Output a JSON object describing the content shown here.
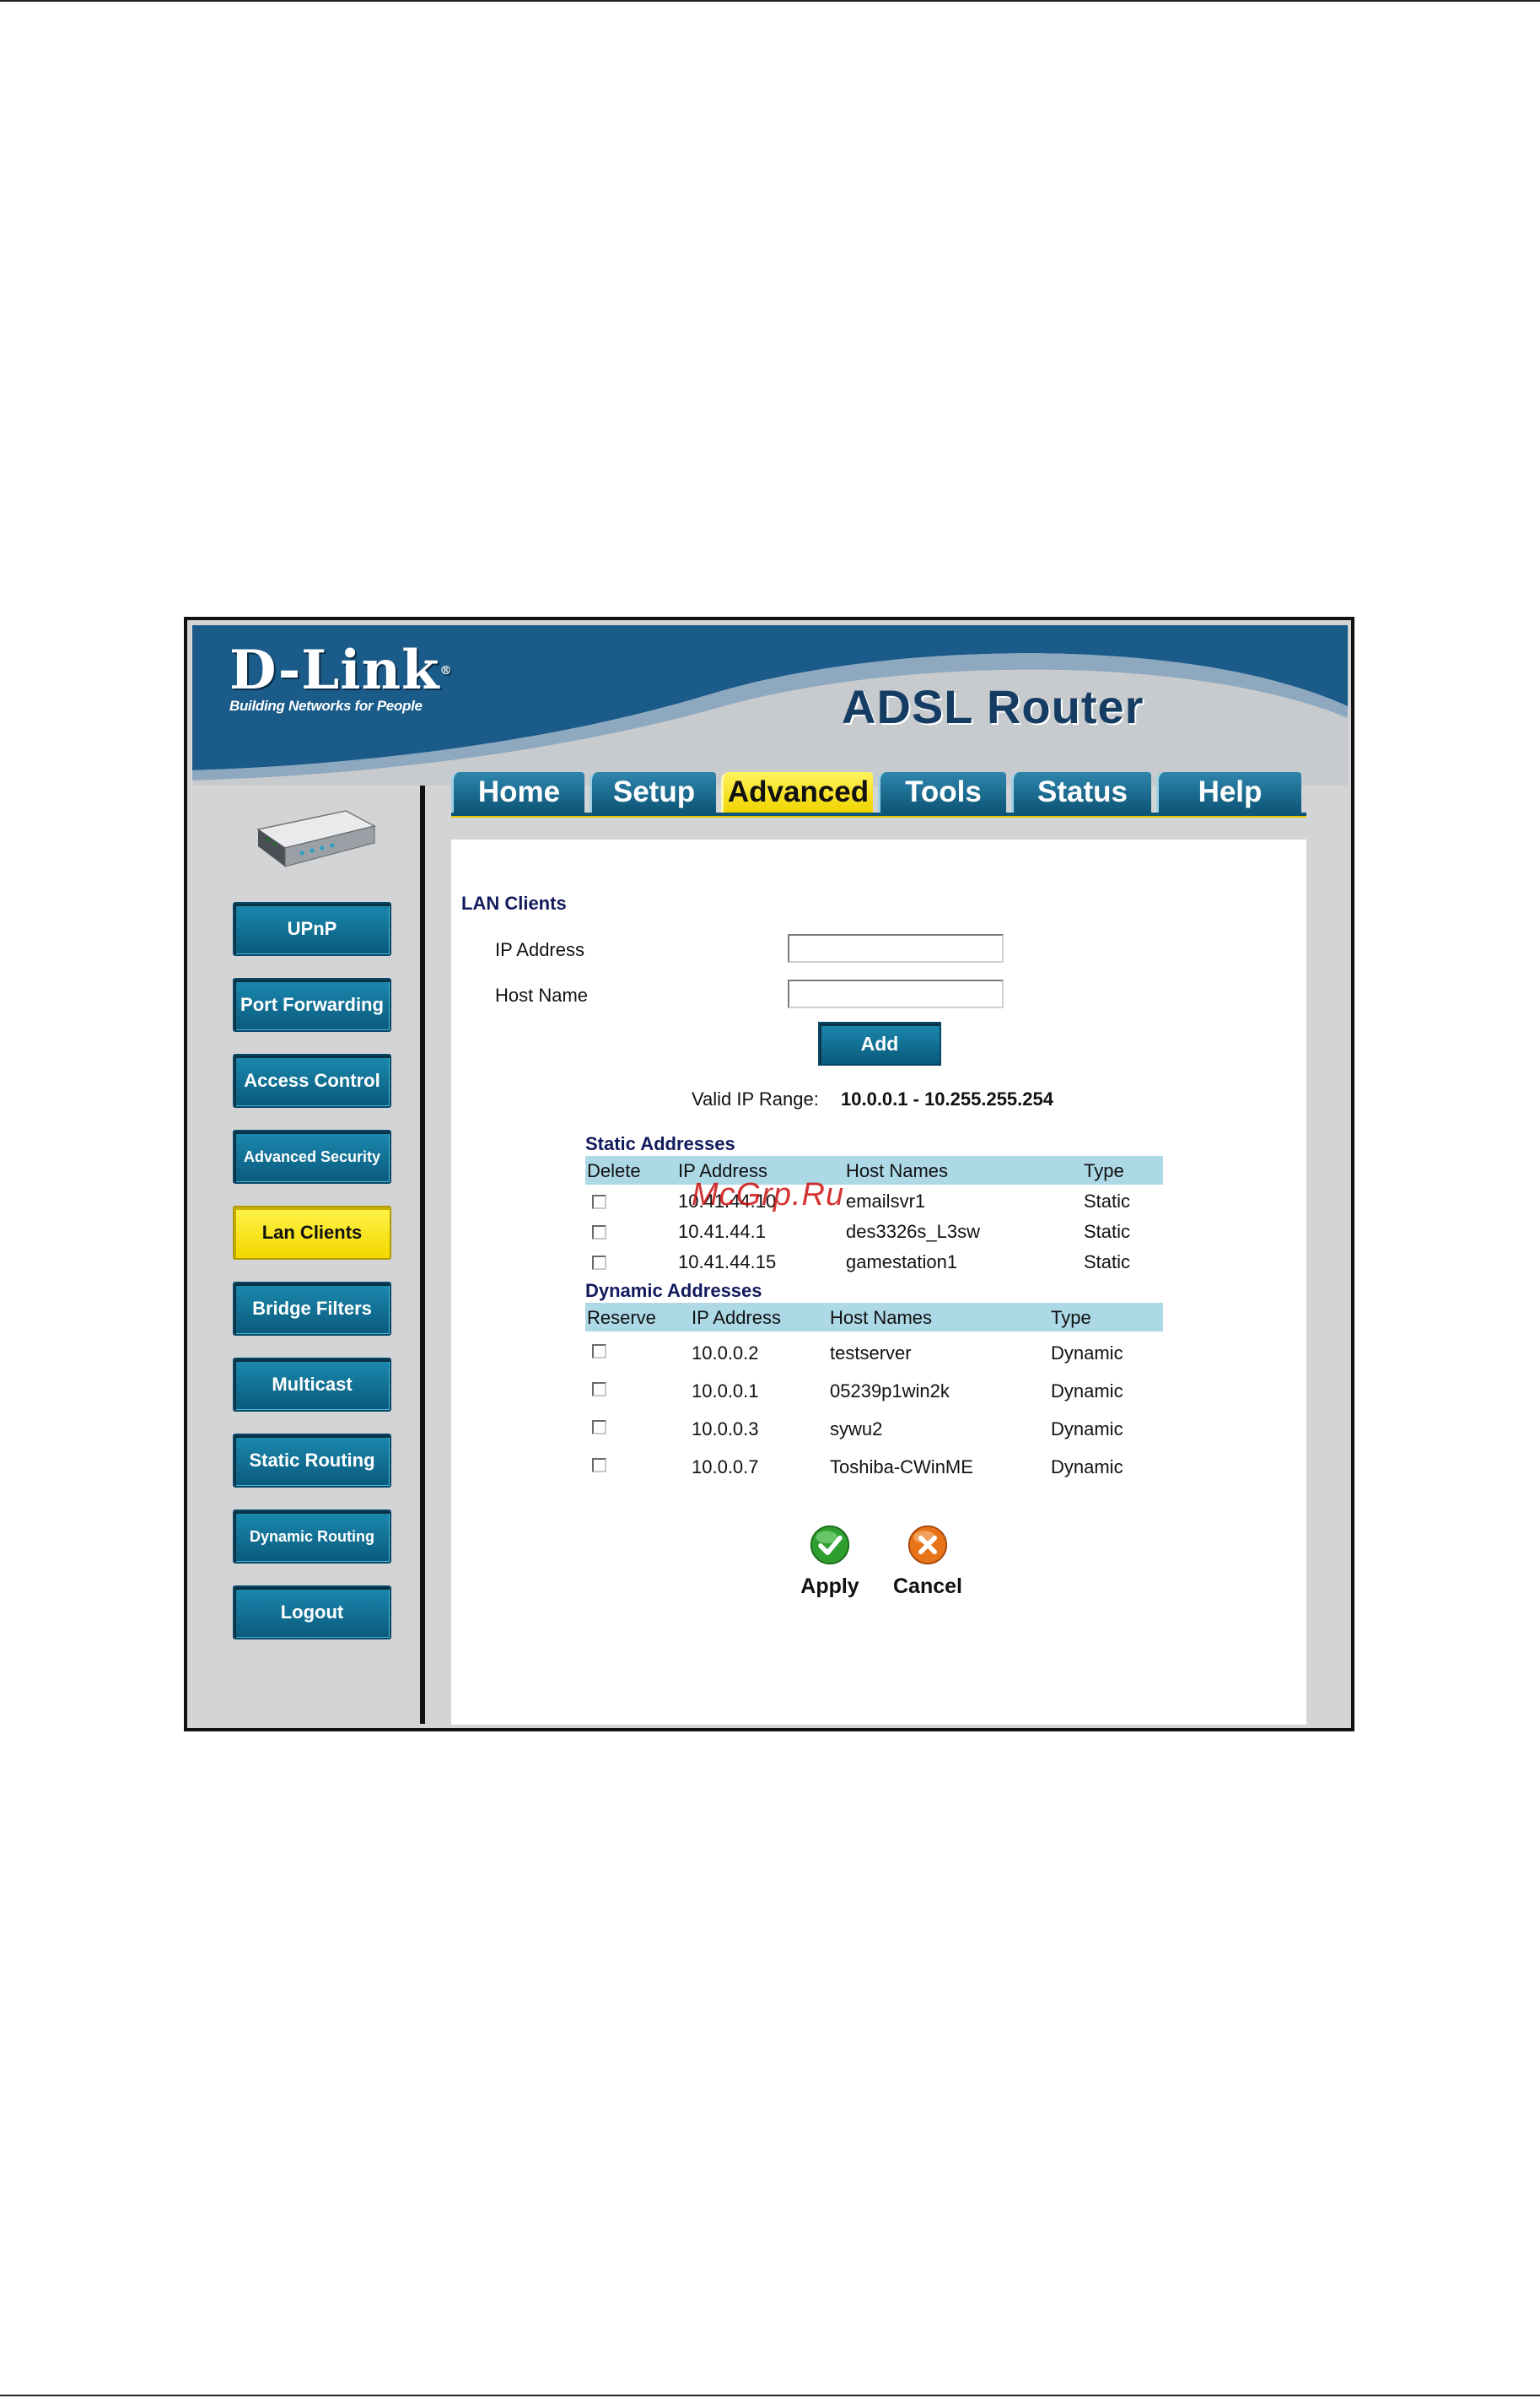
{
  "header": {
    "brand": "D-Link",
    "brand_mark": "®",
    "tagline": "Building Networks for People",
    "product": "ADSL Router"
  },
  "tabs": [
    "Home",
    "Setup",
    "Advanced",
    "Tools",
    "Status",
    "Help"
  ],
  "active_tab": "Advanced",
  "sidebar": {
    "items": [
      "UPnP",
      "Port Forwarding",
      "Access Control",
      "Advanced Security",
      "Lan Clients",
      "Bridge Filters",
      "Multicast",
      "Static Routing",
      "Dynamic Routing",
      "Logout"
    ],
    "active": "Lan Clients"
  },
  "lan_clients": {
    "title": "LAN Clients",
    "ip_label": "IP Address",
    "host_label": "Host Name",
    "ip_value": "",
    "host_value": "",
    "add_label": "Add",
    "valid_label": "Valid IP Range:",
    "valid_range": "10.0.0.1 -  10.255.255.254"
  },
  "static": {
    "title": "Static Addresses",
    "headers": [
      "Delete",
      "IP Address",
      "Host Names",
      "Type"
    ],
    "rows": [
      {
        "ip": "10.41.44.10",
        "host": "emailsvr1",
        "type": "Static"
      },
      {
        "ip": "10.41.44.1",
        "host": "des3326s_L3sw",
        "type": "Static"
      },
      {
        "ip": "10.41.44.15",
        "host": "gamestation1",
        "type": "Static"
      }
    ]
  },
  "dynamic": {
    "title": "Dynamic Addresses",
    "headers": [
      "Reserve",
      "IP Address",
      "Host Names",
      "Type"
    ],
    "rows": [
      {
        "ip": "10.0.0.2",
        "host": "testserver",
        "type": "Dynamic"
      },
      {
        "ip": "10.0.0.1",
        "host": "05239p1win2k",
        "type": "Dynamic"
      },
      {
        "ip": "10.0.0.3",
        "host": "sywu2",
        "type": "Dynamic"
      },
      {
        "ip": "10.0.0.7",
        "host": "Toshiba-CWinME",
        "type": "Dynamic"
      }
    ]
  },
  "actions": {
    "apply": "Apply",
    "cancel": "Cancel"
  },
  "watermark": "McGrp.Ru",
  "icons": {
    "apply": "check-circle-icon",
    "cancel": "x-circle-icon"
  },
  "colors": {
    "header_blue": "#1a5b8a",
    "tab_blue": "#0d5677",
    "active_yellow": "#f3d700",
    "table_header": "#add8e6"
  }
}
